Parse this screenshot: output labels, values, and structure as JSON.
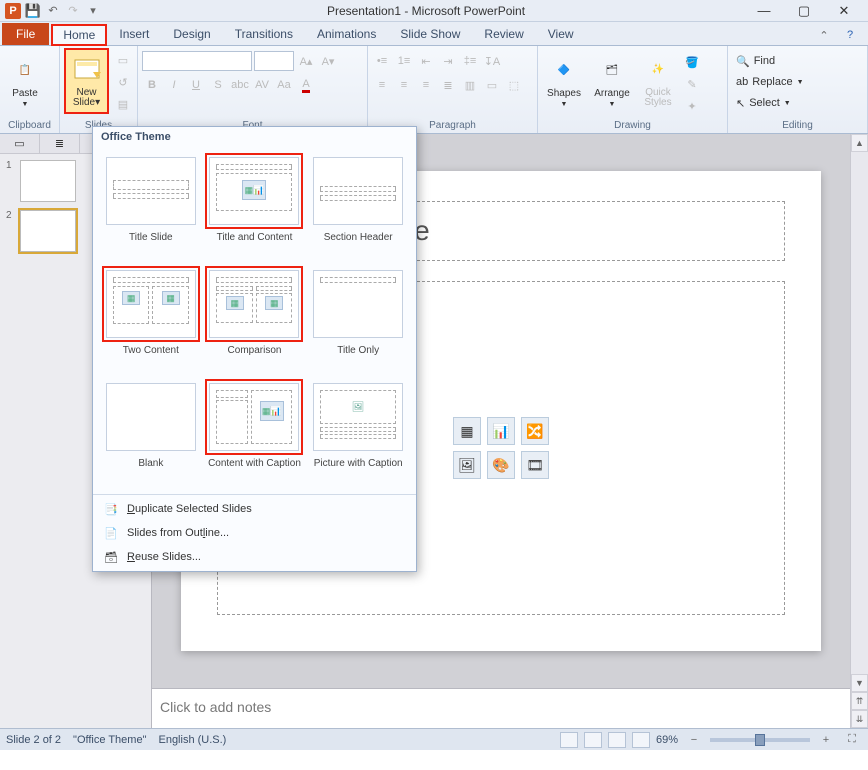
{
  "window": {
    "title": "Presentation1 - Microsoft PowerPoint",
    "minimize": "—",
    "maximize": "▢",
    "close": "✕"
  },
  "tabs": {
    "file": "File",
    "home": "Home",
    "insert": "Insert",
    "design": "Design",
    "transitions": "Transitions",
    "animations": "Animations",
    "slideshow": "Slide Show",
    "review": "Review",
    "view": "View"
  },
  "ribbon": {
    "clipboard": {
      "label": "Clipboard",
      "paste": "Paste"
    },
    "slides": {
      "label": "Slides",
      "new_slide": "New\nSlide"
    },
    "font": {
      "label": "Font"
    },
    "paragraph": {
      "label": "Paragraph"
    },
    "drawing": {
      "label": "Drawing",
      "shapes": "Shapes",
      "arrange": "Arrange",
      "quick": "Quick\nStyles"
    },
    "editing": {
      "label": "Editing",
      "find": "Find",
      "replace": "Replace",
      "select": "Select"
    }
  },
  "gallery": {
    "header": "Office Theme",
    "layouts": [
      {
        "label": "Title Slide"
      },
      {
        "label": "Title and Content"
      },
      {
        "label": "Section Header"
      },
      {
        "label": "Two Content"
      },
      {
        "label": "Comparison"
      },
      {
        "label": "Title Only"
      },
      {
        "label": "Blank"
      },
      {
        "label": "Content with Caption"
      },
      {
        "label": "Picture with Caption"
      }
    ],
    "footer": {
      "duplicate": "Duplicate Selected Slides",
      "outline": "Slides from Outline...",
      "reuse": "Reuse Slides..."
    }
  },
  "canvas": {
    "title_placeholder": "Click to add title"
  },
  "notes": {
    "placeholder": "Click to add notes"
  },
  "status": {
    "slide": "Slide 2 of 2",
    "theme": "\"Office Theme\"",
    "lang": "English (U.S.)",
    "zoom": "69%"
  }
}
